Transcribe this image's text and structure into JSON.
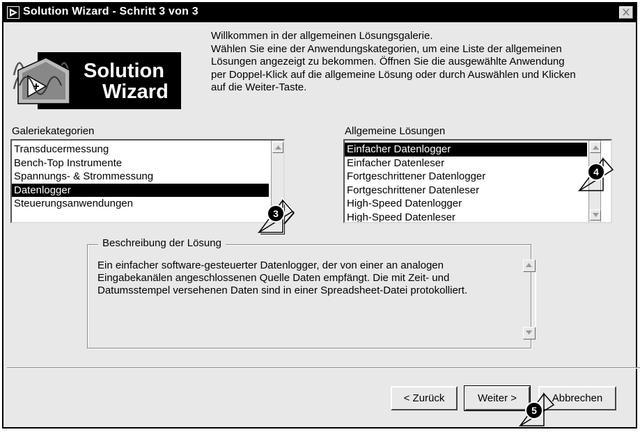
{
  "window": {
    "title": "Solution Wizard - Schritt 3 von 3"
  },
  "logo": {
    "line1": "Solution",
    "line2": "Wizard"
  },
  "intro": {
    "lines": [
      "Willkommen in der allgemeinen Lösungsgalerie.",
      "Wählen Sie eine der Anwendungskategorien, um eine Liste der allgemeinen",
      "Lösungen angezeigt zu bekommen.  Öffnen Sie die ausgewählte Anwendung",
      "per Doppel-Klick auf die allgemeine Lösung oder durch Auswählen und Klicken",
      "auf die Weiter-Taste."
    ]
  },
  "categories": {
    "label": "Galeriekategorien",
    "items": [
      "Transducermessung",
      "Bench-Top Instrumente",
      "Spannungs- & Strommessung",
      "Datenlogger",
      "Steuerungsanwendungen"
    ],
    "selected": "Datenlogger"
  },
  "solutions": {
    "label": "Allgemeine Lösungen",
    "items": [
      "Einfacher Datenlogger",
      "Einfacher Datenleser",
      "Fortgeschrittener Datenlogger",
      "Fortgeschrittener Datenleser",
      "High-Speed Datenlogger",
      "High-Speed Datenleser"
    ],
    "selected": "Einfacher Datenlogger"
  },
  "description": {
    "title": "Beschreibung der Lösung",
    "lines": [
      "Ein einfacher software-gesteuerter Datenlogger, der von einer an analogen",
      "Eingabekanälen angeschlossenen Quelle Daten empfängt.  Die mit Zeit- und",
      "Datumsstempel versehenen Daten sind in einer Spreadsheet-Datei protokolliert."
    ]
  },
  "buttons": {
    "back": "< Zurück",
    "next": "Weiter >",
    "cancel": "Abbrechen"
  },
  "callouts": {
    "c3": "3",
    "c4": "4",
    "c5": "5"
  }
}
